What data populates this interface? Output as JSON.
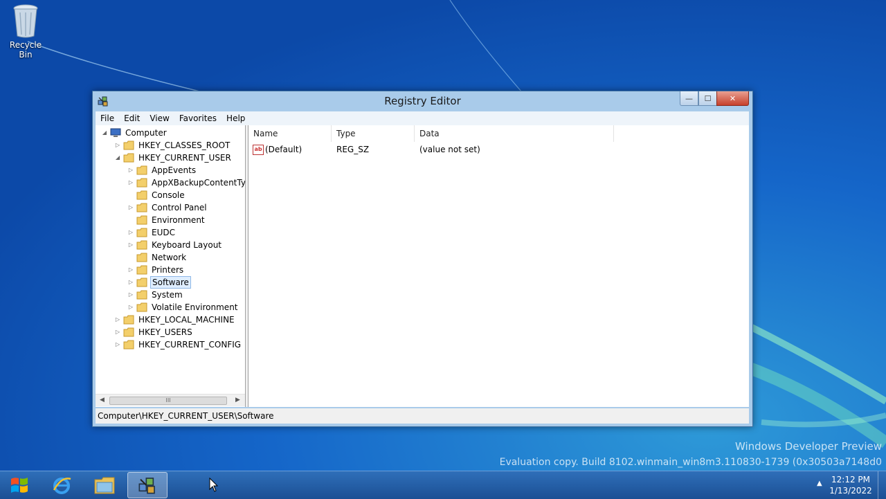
{
  "desktop": {
    "icons": [
      {
        "label": "Recycle Bin",
        "icon": "recycle-bin-icon"
      }
    ],
    "watermark_line1": "Windows Developer Preview",
    "watermark_line2": "Evaluation copy. Build 8102.winmain_win8m3.110830-1739 (0x30503a7148d0"
  },
  "window": {
    "title": "Registry Editor",
    "buttons": {
      "minimize": "—",
      "maximize": "☐",
      "close": "✕"
    }
  },
  "menu": [
    "File",
    "Edit",
    "View",
    "Favorites",
    "Help"
  ],
  "tree": {
    "root": "Computer",
    "hives": {
      "hkcr": "HKEY_CLASSES_ROOT",
      "hkcu": "HKEY_CURRENT_USER",
      "hklm": "HKEY_LOCAL_MACHINE",
      "hku": "HKEY_USERS",
      "hkcc": "HKEY_CURRENT_CONFIG"
    },
    "hkcu_children": [
      "AppEvents",
      "AppXBackupContentTyp",
      "Console",
      "Control Panel",
      "Environment",
      "EUDC",
      "Keyboard Layout",
      "Network",
      "Printers",
      "Software",
      "System",
      "Volatile Environment"
    ],
    "selected": "Software",
    "scroll_thumb_grip": "III"
  },
  "list": {
    "columns": [
      "Name",
      "Type",
      "Data"
    ],
    "rows": [
      {
        "name": "(Default)",
        "type": "REG_SZ",
        "data": "(value not set)",
        "icon_text": "ab"
      }
    ]
  },
  "status": "Computer\\HKEY_CURRENT_USER\\Software",
  "taskbar": {
    "items": [
      "start-orb",
      "internet-explorer",
      "file-explorer",
      "registry-editor"
    ],
    "active": "registry-editor",
    "time": "12:12 PM",
    "date": "1/13/2022"
  },
  "colors": {
    "desktop": "#1158c2",
    "window_frame": "#a9cbea",
    "taskbar": "#2f6fb9",
    "selection": "#dfeeff"
  }
}
